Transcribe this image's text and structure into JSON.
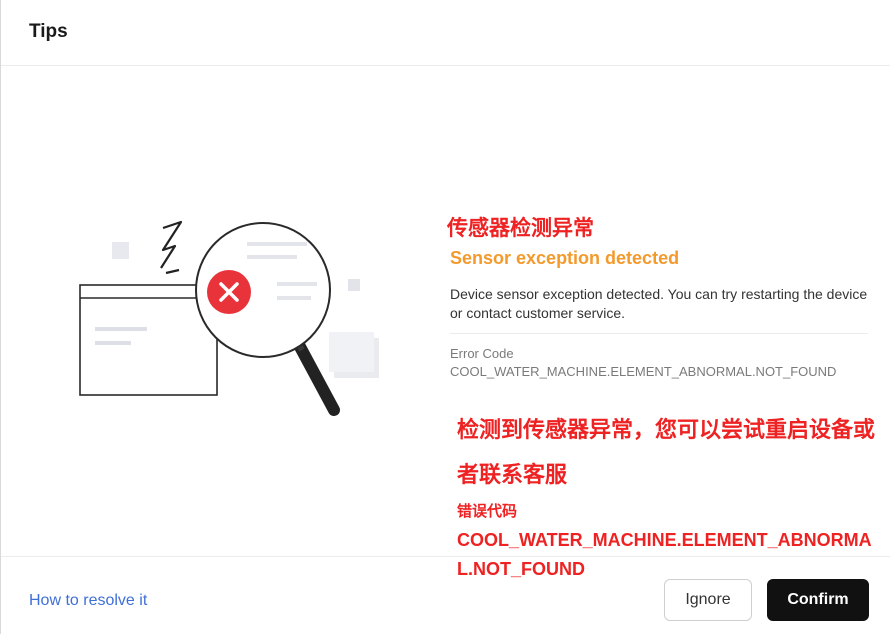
{
  "dialog": {
    "title": "Tips"
  },
  "message": {
    "zh_title": "传感器检测异常",
    "en_title": "Sensor exception detected",
    "description": "Device sensor exception detected. You can try restarting the device or contact customer service.",
    "error_code_label": "Error Code",
    "error_code_value": "COOL_WATER_MACHINE.ELEMENT_ABNORMAL.NOT_FOUND",
    "zh_description": "检测到传感器异常，您可以尝试重启设备或者联系客服",
    "zh_error_code_label": "错误代码",
    "zh_error_code_value": "COOL_WATER_MACHINE.ELEMENT_ABNORMAL.NOT_FOUND"
  },
  "footer": {
    "resolve_link": "How to resolve it",
    "ignore_label": "Ignore",
    "confirm_label": "Confirm"
  },
  "colors": {
    "accent_red": "#ee2222",
    "warning_orange": "#f39a2c",
    "link_blue": "#3f6fd8",
    "confirm_bg": "#111111"
  }
}
